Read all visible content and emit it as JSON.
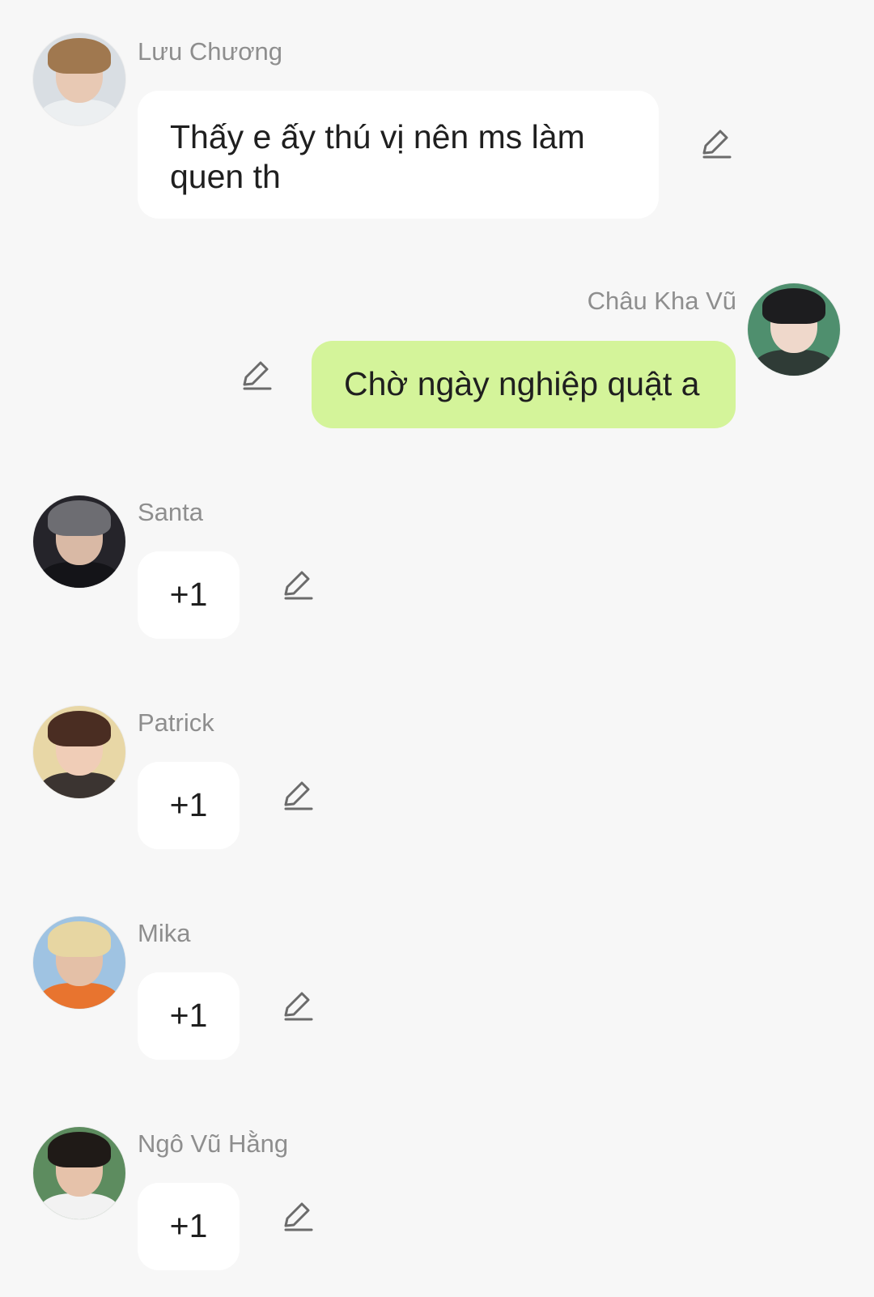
{
  "messages": [
    {
      "sender": "Lưu Chương",
      "text": "Thấy e ấy thú vị nên ms làm quen th"
    },
    {
      "sender": "Châu Kha Vũ",
      "text": "Chờ ngày nghiệp quật a"
    },
    {
      "sender": "Santa",
      "text": "+1"
    },
    {
      "sender": "Patrick",
      "text": "+1"
    },
    {
      "sender": "Mika",
      "text": "+1"
    },
    {
      "sender": "Ngô Vũ Hằng",
      "text": "+1"
    }
  ],
  "icons": {
    "edit": "pencil-edit-icon"
  },
  "colors": {
    "background": "#f7f7f7",
    "incoming_bubble": "#ffffff",
    "outgoing_bubble": "#d4f49a",
    "sender_name": "#8e8e8e",
    "icon_stroke": "#6b6b6b"
  }
}
